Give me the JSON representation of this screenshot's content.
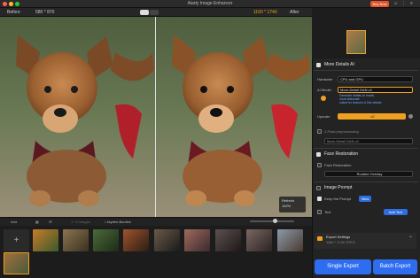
{
  "window": {
    "title": "Aiarty Image Enhancer",
    "buy_label": "Buy Now"
  },
  "viewer": {
    "before_label": "Before",
    "before_size": "580 * 870",
    "after_size": "1160 * 1740",
    "after_label": "After",
    "zoom_label": "Refresh",
    "zoom_value": "152%"
  },
  "filmstrip": {
    "add_label": "Add",
    "count_text": "1 / 8 images",
    "author_text": "/ Jayden-Burdick",
    "add_symbol": "+"
  },
  "panel": {
    "more_details": {
      "title": "More Details AI",
      "hardware_label": "Hardware",
      "hardware_value": "CPU and GPU",
      "model_label": "AI Model",
      "model_value": "More-Detail GAN v2",
      "model_desc_1": "Generate details AI model,",
      "model_desc_2": "more elaborate",
      "model_desc_3": "suited for textures & fine details",
      "upscale_label": "Upscale",
      "upscale_value": "x2",
      "preprocess_label": "2-Pass preprocessing",
      "preprocess_value": "More-Detail GAN v2"
    },
    "face": {
      "title": "Face Restoration",
      "option_label": "Face Restoration",
      "option_value": "Routine Overlay"
    },
    "prompt": {
      "title": "Image Prompt",
      "keep_label": "Keep the Prompt",
      "view_label": "View",
      "text_label": "Text",
      "add_text_label": "Add Text"
    },
    "export": {
      "settings_title": "Export Settings",
      "settings_detail": "1160 * 1740 JPEG",
      "single_label": "Single Export",
      "batch_label": "Batch Export"
    }
  },
  "colors": {
    "accent_orange": "#f0a020",
    "accent_blue": "#2e6cf0",
    "buy_red": "#e8542a"
  }
}
